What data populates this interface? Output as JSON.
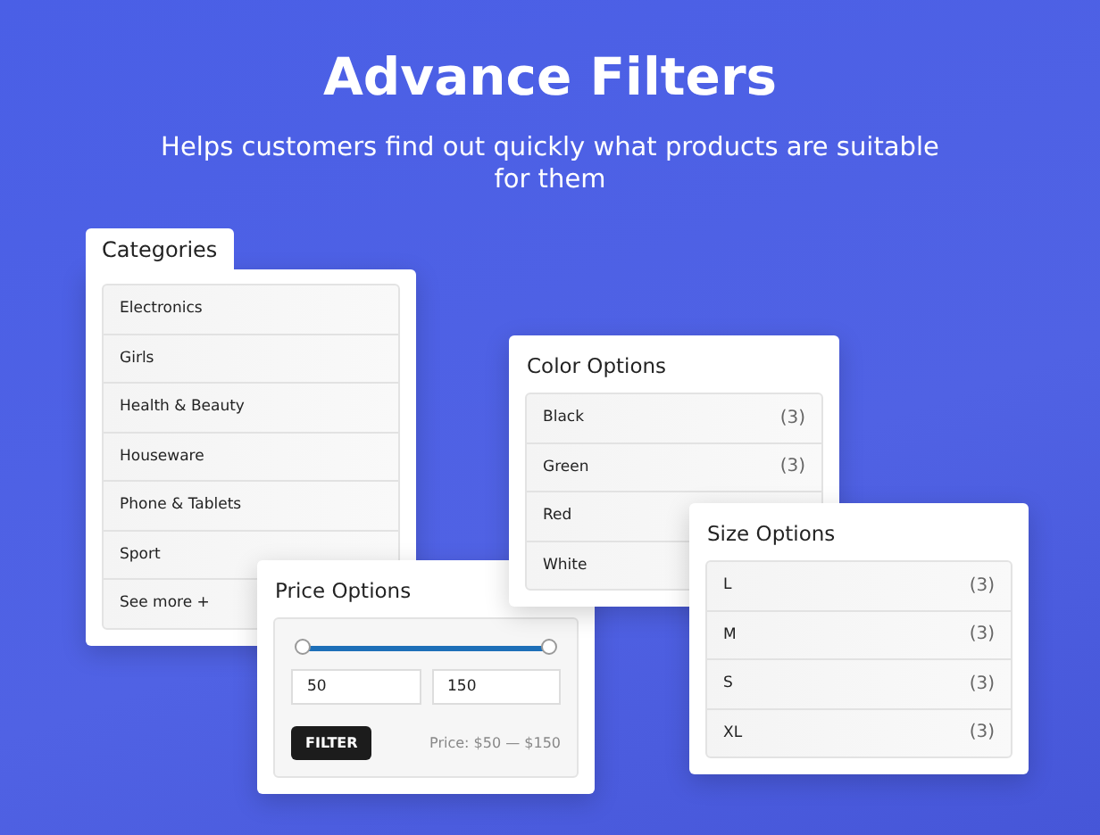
{
  "heading": "Advance Filters",
  "subheading": "Helps customers find out quickly what products are suitable for them",
  "panels": [
    {
      "kind": "list",
      "title": "Categories",
      "items": [
        {
          "label": "Electronics"
        },
        {
          "label": "Girls"
        },
        {
          "label": "Health & Beauty"
        },
        {
          "label": "Houseware"
        },
        {
          "label": "Phone & Tablets"
        },
        {
          "label": "Sport"
        },
        {
          "label": "See more +"
        }
      ]
    },
    {
      "kind": "price",
      "title": "Price Options",
      "slider": {
        "level": 1
      },
      "min_value": "50",
      "max_value": "150",
      "button": "FILTER",
      "range_text": "Price: $50 — $150"
    },
    {
      "kind": "list",
      "title": "Color Options",
      "items": [
        {
          "label": "Black",
          "count": "(3)"
        },
        {
          "label": "Green",
          "count": "(3)"
        },
        {
          "label": "Red"
        },
        {
          "label": "White"
        }
      ]
    },
    {
      "kind": "list",
      "title": "Size Options",
      "items": [
        {
          "label": "L",
          "count": "(3)"
        },
        {
          "label": "M",
          "count": "(3)"
        },
        {
          "label": "S",
          "count": "(3)"
        },
        {
          "label": "XL",
          "count": "(3)"
        }
      ]
    }
  ]
}
